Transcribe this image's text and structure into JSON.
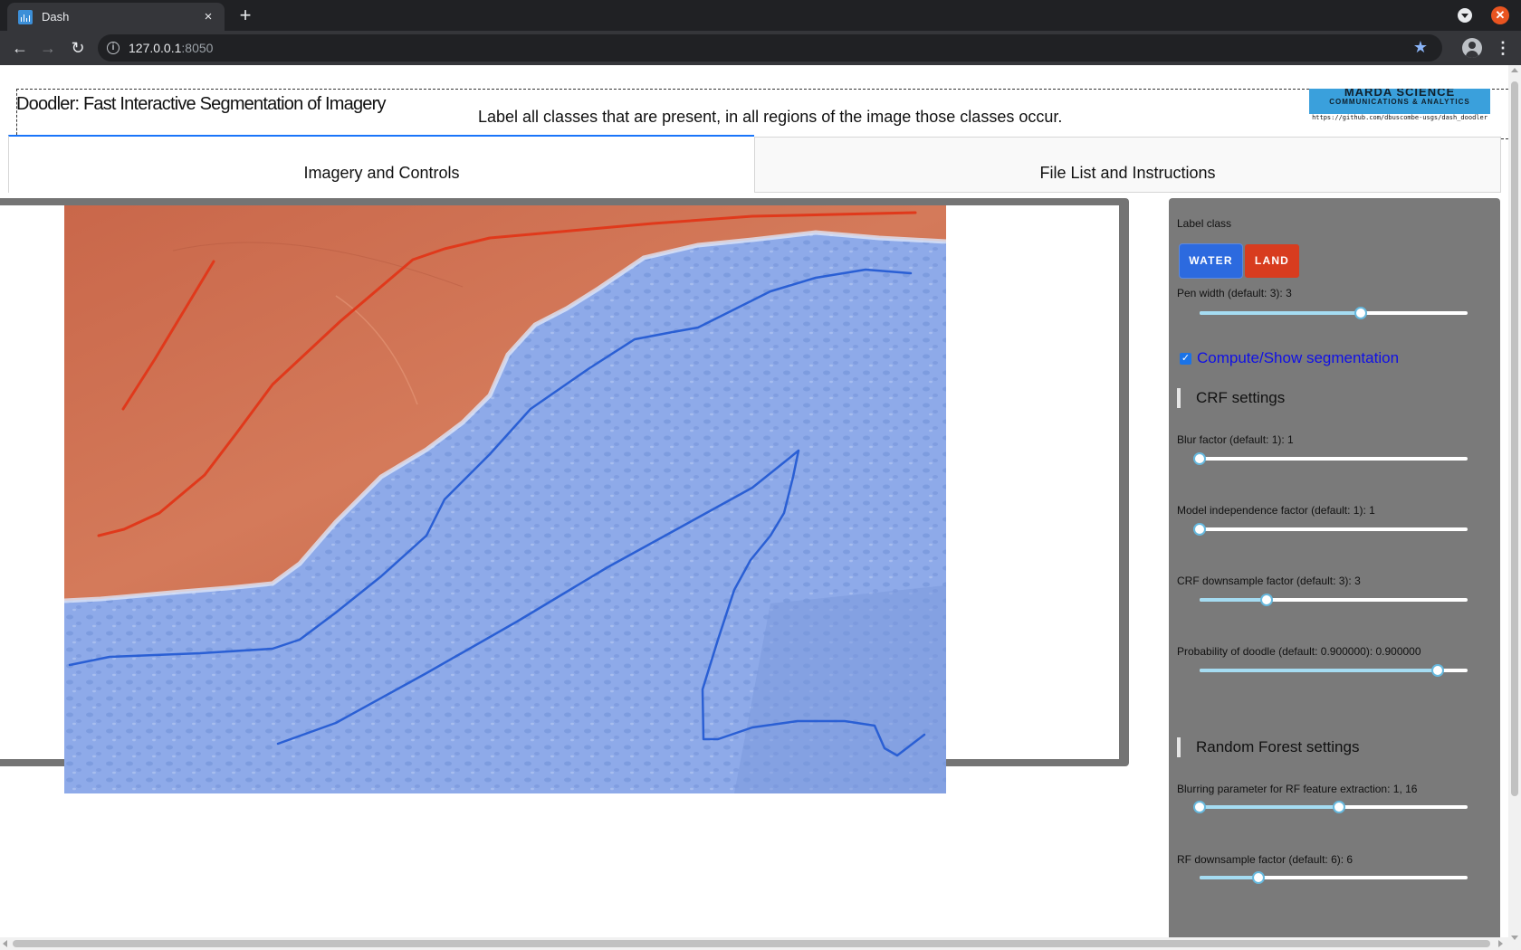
{
  "browser": {
    "tab_title": "Dash",
    "new_tab_label": "+",
    "close_tab_label": "×",
    "url_host": "127.0.0.1",
    "url_port": ":8050"
  },
  "header": {
    "title": "Doodler: Fast Interactive Segmentation of Imagery",
    "instruction": "Label all classes that are present, in all regions of the image those classes occur.",
    "logo_title": "MARDA SCIENCE",
    "logo_subtitle": "COMMUNICATIONS & ANALYTICS",
    "logo_url": "https://github.com/dbuscombe-usgs/dash_doodler"
  },
  "tabs": [
    {
      "label": "Imagery and Controls",
      "selected": true
    },
    {
      "label": "File List and Instructions",
      "selected": false
    }
  ],
  "colors": {
    "water": "#2c6adf",
    "land": "#d83c1f",
    "water_overlay": "#8eaae9",
    "land_overlay": "#cd7050",
    "panel_gray": "#7a7a7a",
    "slider_accent": "#a5dcf2"
  },
  "controls": {
    "label_class_title": "Label class",
    "classes": [
      "WATER",
      "LAND"
    ],
    "pen_width": {
      "label": "Pen width (default: 3): 3",
      "value": 3,
      "min": 1,
      "max": 5,
      "fraction": 0.6
    },
    "segmentation": {
      "label": "Compute/Show segmentation",
      "checked": true
    },
    "crf_title": "CRF settings",
    "blur_factor": {
      "label": "Blur factor (default: 1): 1",
      "value": 1,
      "fraction": 0.0
    },
    "model_independence": {
      "label": "Model independence factor (default: 1): 1",
      "value": 1,
      "fraction": 0.0
    },
    "crf_downsample": {
      "label": "CRF downsample factor (default: 3): 3",
      "value": 3,
      "fraction": 0.25
    },
    "doodle_probability": {
      "label": "Probability of doodle (default: 0.900000): 0.900000",
      "value": 0.9,
      "fraction": 0.89
    },
    "rf_title": "Random Forest settings",
    "rf_blur": {
      "label": "Blurring parameter for RF feature extraction: 1, 16",
      "low": 1,
      "high": 16,
      "low_fraction": 0.0,
      "high_fraction": 0.52
    },
    "rf_downsample": {
      "label": "RF downsample factor (default: 6): 6",
      "value": 6,
      "fraction": 0.22
    }
  }
}
